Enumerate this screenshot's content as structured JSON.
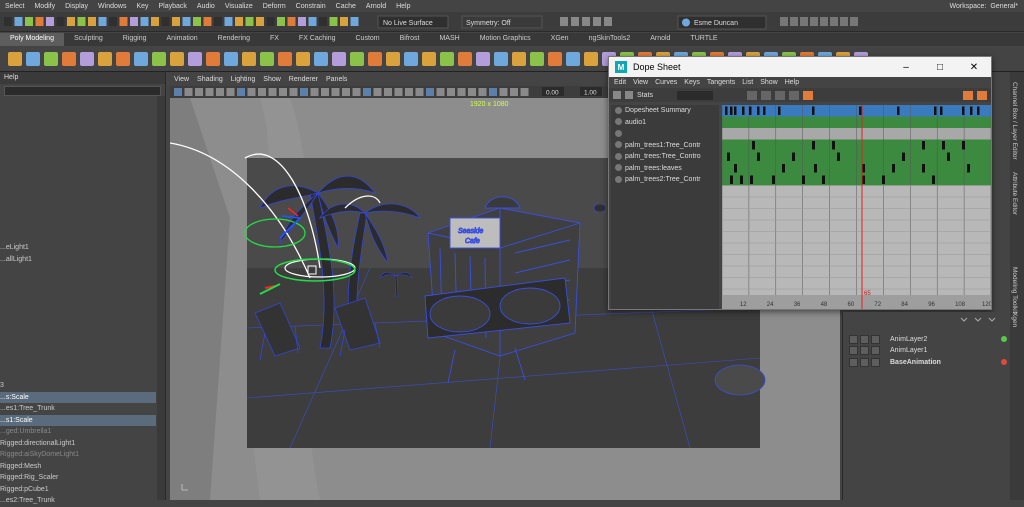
{
  "menubar": {
    "items": [
      "Select",
      "Modify",
      "Display",
      "Windows",
      "Key",
      "Playback",
      "Audio",
      "Visualize",
      "Deform",
      "Constrain",
      "Cache",
      "Arnold",
      "Help"
    ],
    "workspace_label": "Workspace:",
    "workspace_value": "General*"
  },
  "statusline": {
    "live_surface": "No Live Surface",
    "symmetry": "Symmetry: Off",
    "user": "Esme Duncan"
  },
  "shelf_tabs": [
    "Poly Modeling",
    "Sculpting",
    "Rigging",
    "Animation",
    "Rendering",
    "FX",
    "FX Caching",
    "Custom",
    "Bifrost",
    "MASH",
    "Motion Graphics",
    "XGen",
    "ngSkinTools2",
    "Arnold",
    "TURTLE"
  ],
  "outliner": {
    "help_label": "Help",
    "items": [
      {
        "label": "...eLight1",
        "state": "normal"
      },
      {
        "label": "...allLight1",
        "state": "normal"
      },
      {
        "label": "",
        "state": "normal"
      },
      {
        "label": "",
        "state": "normal"
      },
      {
        "label": "",
        "state": "normal"
      },
      {
        "label": "",
        "state": "normal"
      },
      {
        "label": "",
        "state": "normal"
      },
      {
        "label": "",
        "state": "normal"
      },
      {
        "label": "",
        "state": "normal"
      },
      {
        "label": "",
        "state": "normal"
      },
      {
        "label": "",
        "state": "normal"
      },
      {
        "label": "",
        "state": "normal"
      },
      {
        "label": "3",
        "state": "normal"
      },
      {
        "label": "...s:Scale",
        "state": "selected"
      },
      {
        "label": "...es1:Tree_Trunk",
        "state": "normal"
      },
      {
        "label": "...s1:Scale",
        "state": "selected"
      },
      {
        "label": "...ged:Umbrella1",
        "state": "dim"
      },
      {
        "label": "Rigged:directionalLight1",
        "state": "normal"
      },
      {
        "label": "Rigged:aiSkyDomeLight1",
        "state": "dim"
      },
      {
        "label": "Rigged:Mesh",
        "state": "normal"
      },
      {
        "label": "Rigged:Rig_Scaler",
        "state": "normal"
      },
      {
        "label": "Rigged:pCube1",
        "state": "normal"
      },
      {
        "label": "...es2:Tree_Trunk",
        "state": "normal"
      }
    ]
  },
  "viewport": {
    "menu": [
      "View",
      "Shading",
      "Lighting",
      "Show",
      "Renderer",
      "Panels"
    ],
    "resolution": "1920 x 1080",
    "field_a": "0.00",
    "field_b": "1.00"
  },
  "dopesheet": {
    "title": "Dope Sheet",
    "menu": [
      "Edit",
      "View",
      "Curves",
      "Keys",
      "Tangents",
      "List",
      "Show",
      "Help"
    ],
    "stats_label": "Stats",
    "rows": [
      "Dopesheet Summary",
      "audio1",
      "",
      "palm_trees1:Tree_Contr",
      "palm_trees:Tree_Contro",
      "palm_trees:leaves",
      "palm_trees2:Tree_Contr"
    ],
    "ticks": [
      "12",
      "24",
      "36",
      "48",
      "60",
      "72",
      "84",
      "96",
      "108",
      "120"
    ],
    "current_frame": "65"
  },
  "right_tabs": [
    "Channel Box / Layer Editor",
    "Attribute Editor",
    "Modeling Toolkit",
    "Xgen"
  ],
  "anim_layers": [
    {
      "name": "AnimLayer2",
      "dot": "#5ac84a"
    },
    {
      "name": "AnimLayer1",
      "dot": ""
    },
    {
      "name": "BaseAnimation",
      "dot": "#e04a3a"
    }
  ]
}
